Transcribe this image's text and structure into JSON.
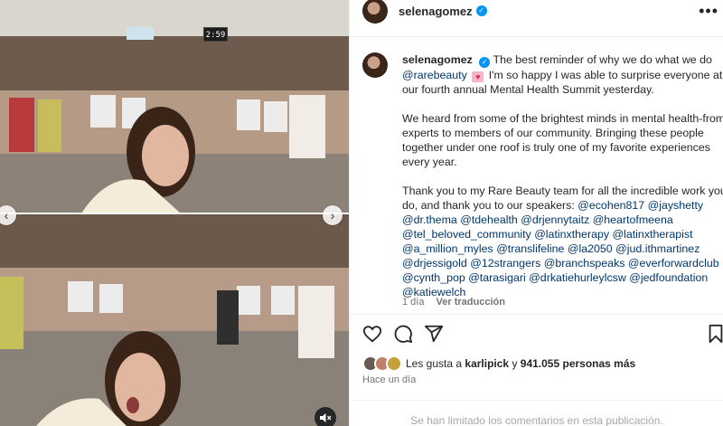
{
  "post": {
    "username": "selenagomez",
    "verified": true
  },
  "media": {
    "timer": "2:59"
  },
  "caption": {
    "username": "selenagomez",
    "line1": "The best reminder of why we do what we do",
    "mention_rarebeauty": "@rarebeauty",
    "line1_after": "I'm so happy I was able to surprise everyone at our fourth annual Mental Health Summit yesterday.",
    "paragraph2": "We heard from some of the brightest minds in mental health-from experts to members of our community. Bringing these people together under one roof is truly one of my favorite experiences every year.",
    "paragraph3": "Thank you to my Rare Beauty team for all the incredible work you do, and thank you to our speakers:",
    "speakers": [
      "@ecohen817",
      "@jayshetty",
      "@dr.thema",
      "@tdehealth",
      "@drjennytaitz",
      "@heartofmeena",
      "@tel_beloved_community",
      "@latinxtherapy",
      "@latinxtherapist",
      "@a_million_myles",
      "@translifeline",
      "@la2050",
      "@jud.ithmartinez",
      "@drjessigold",
      "@12strangers",
      "@branchspeaks",
      "@everforwardclub",
      "@cynth_pop",
      "@tarasigari",
      "@drkatiehurleylcsw",
      "@jedfoundation",
      "@katiewelch"
    ],
    "time": "1 día",
    "translate": "Ver traducción"
  },
  "likes": {
    "prefix": "Les gusta a",
    "first_user": "karlipick",
    "connector": "y",
    "count": "941.055 personas más"
  },
  "time_ago": "Hace un día",
  "comments_limited": "Se han limitado los comentarios en esta publicación.",
  "icons": {
    "verified": "verified-badge-icon",
    "more": "more-options-icon",
    "like": "heart-icon",
    "comment": "comment-icon",
    "share": "share-icon",
    "save": "bookmark-icon",
    "mute": "speaker-muted-icon",
    "prev": "chevron-left-icon",
    "next": "chevron-right-icon"
  },
  "colors": {
    "link": "#00376b",
    "verified": "#0095f6",
    "secondary_text": "#737373"
  }
}
